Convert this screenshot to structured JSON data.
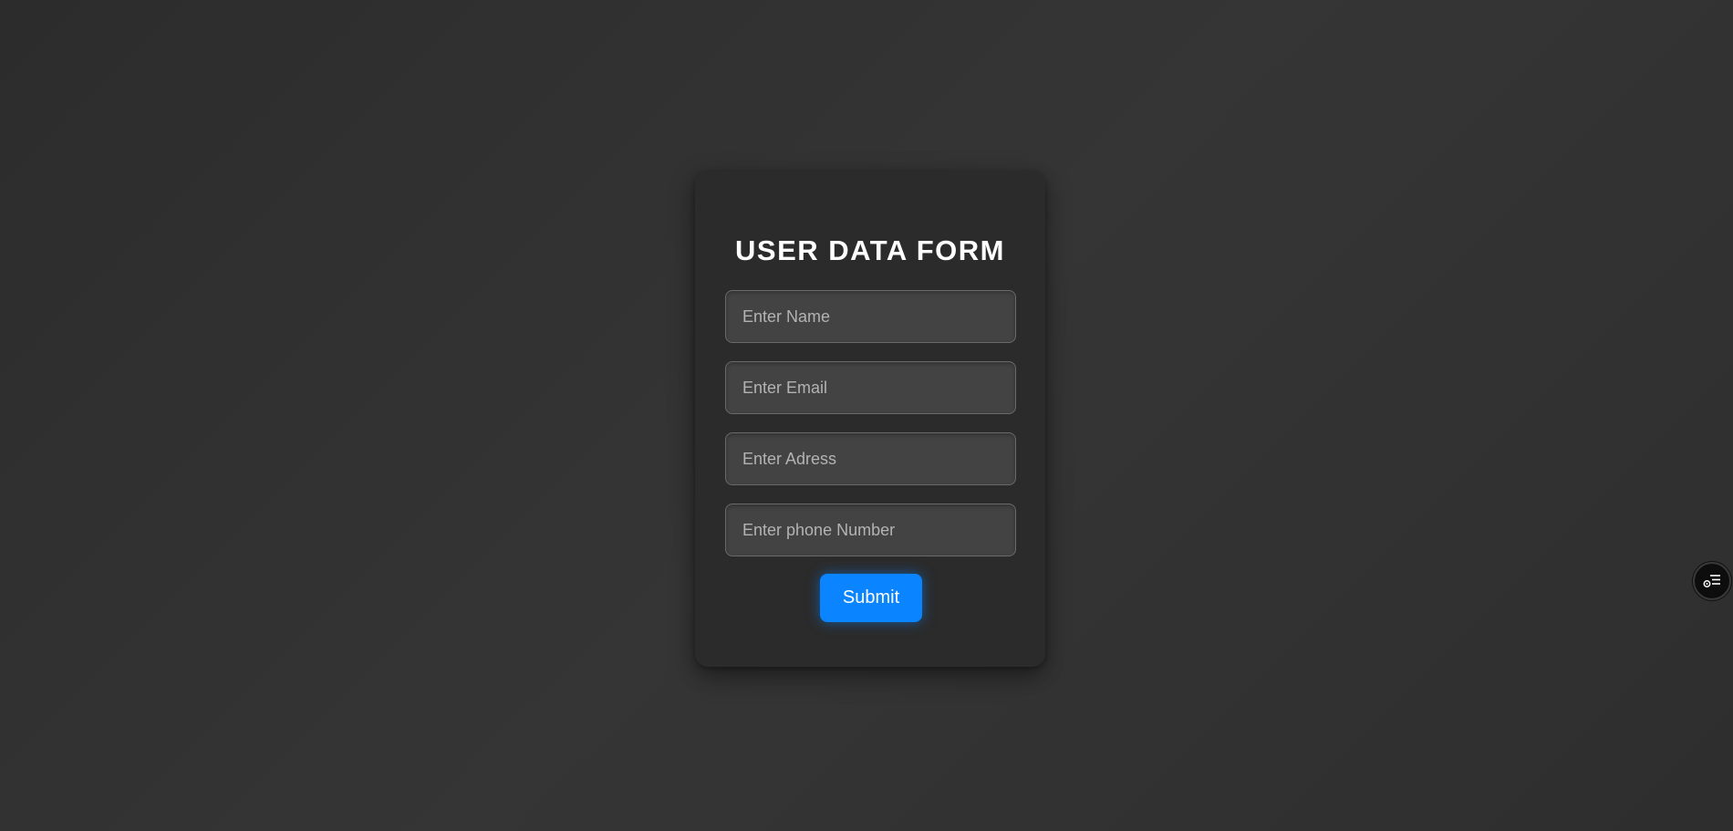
{
  "form": {
    "title": "USER DATA FORM",
    "fields": [
      {
        "placeholder": "Enter Name",
        "value": ""
      },
      {
        "placeholder": "Enter Email",
        "value": ""
      },
      {
        "placeholder": "Enter Adress",
        "value": ""
      },
      {
        "placeholder": "Enter phone Number",
        "value": ""
      }
    ],
    "submit_label": "Submit"
  },
  "widget": {
    "icon": "settings-list-icon"
  },
  "colors": {
    "background": "#2f2f2f",
    "card": "#2b2b2b",
    "input_bg": "#434343",
    "accent": "#0a84ff",
    "title_text": "#ffffff"
  }
}
